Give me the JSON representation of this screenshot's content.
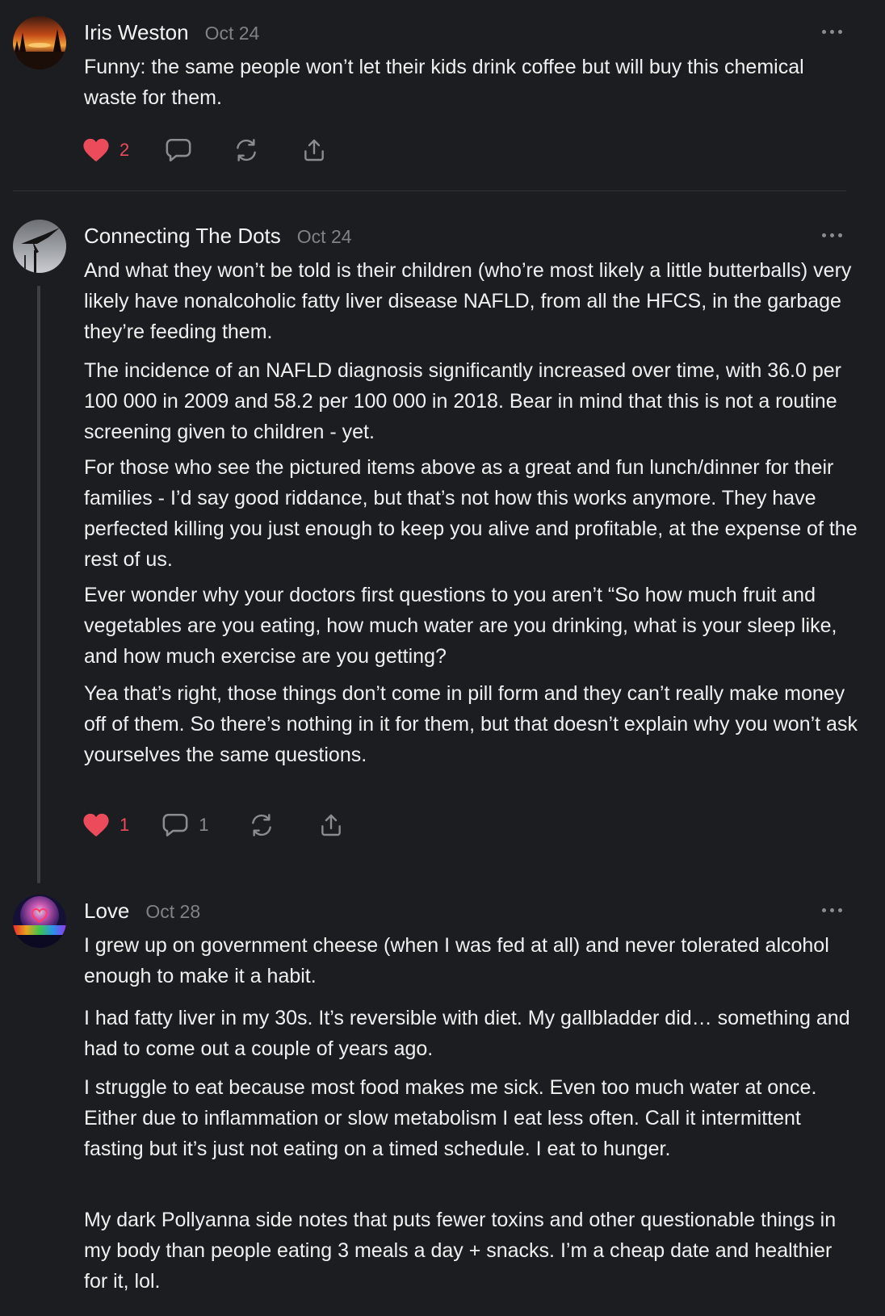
{
  "colors": {
    "background": "#1c1d20",
    "heart": "#ec4b5c",
    "icon_grey": "#8a8c91"
  },
  "comments": [
    {
      "author": "Iris Weston",
      "date": "Oct 24",
      "avatar": "sunset-avatar",
      "paragraphs": [
        "Funny: the same people won’t let their kids drink coffee but will buy this chemical waste for them."
      ],
      "likes": "2",
      "replies": ""
    },
    {
      "author": "Connecting The Dots",
      "date": "Oct 24",
      "avatar": "bird-silhouette-avatar",
      "paragraphs": [
        "And what they won’t be told is their children (who’re most likely a little butterballs) very likely have nonalcoholic fatty liver disease NAFLD, from all the HFCS, in the garbage they’re feeding them.",
        "The incidence of an NAFLD diagnosis significantly increased over time, with 36.0 per 100 000 in 2009 and 58.2 per 100 000 in 2018. Bear in mind that this is not a routine screening given to children - yet.",
        "For those who see the pictured items above as a great and fun lunch/dinner for their families - I’d say good riddance, but that’s not how this works anymore. They have perfected killing you just enough to keep you alive and profitable, at the expense of the rest of us.",
        "Ever wonder why your doctors first questions to you aren’t “So how much fruit and vegetables are you eating, how much water are you drinking, what is your sleep like, and how much exercise are you getting?",
        "Yea that’s right, those things don’t come in pill form and they can’t really make money off of them. So there’s nothing in it for them, but that doesn’t explain why you won’t ask yourselves the same questions."
      ],
      "likes": "1",
      "replies": "1"
    },
    {
      "author": "Love",
      "date": "Oct 28",
      "avatar": "rainbow-heart-avatar",
      "paragraphs": [
        "I grew up on government cheese (when I was fed at all) and never tolerated alcohol enough to make it a habit.",
        "I had fatty liver in my 30s. It’s reversible with diet. My gallbladder did… something and had to come out a couple of years ago.",
        "I struggle to eat because most food makes me sick. Even too much water at once. Either due to inflammation or slow metabolism I eat less often. Call it intermittent fasting but it’s just not eating on a timed schedule. I eat to hunger.",
        "My dark Pollyanna side notes that puts fewer toxins and other questionable things in my body than people eating 3 meals a day + snacks. I’m a cheap date and healthier for it, lol."
      ]
    }
  ]
}
